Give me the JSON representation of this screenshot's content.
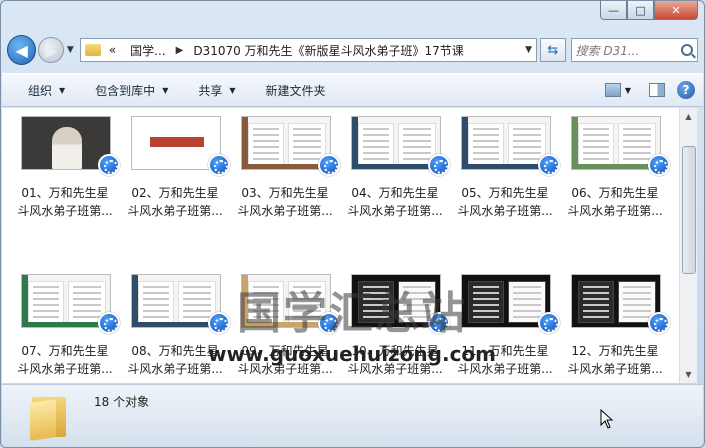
{
  "window": {
    "min_label": "—",
    "max_label": "□",
    "close_label": "✕"
  },
  "nav": {
    "back_glyph": "◀",
    "forward_glyph": "▶",
    "dropdown_glyph": "▼"
  },
  "address": {
    "overflow": "«",
    "crumbs": [
      "国学...",
      "D31070 万和先生《新版星斗风水弟子班》17节课"
    ],
    "sep_glyph": "▶",
    "dropdown_glyph": "▼",
    "refresh_glyph": "⇆"
  },
  "search": {
    "placeholder": "搜索 D31..."
  },
  "toolbar": {
    "items": [
      {
        "label": "组织",
        "has_dropdown": true
      },
      {
        "label": "包含到库中",
        "has_dropdown": true
      },
      {
        "label": "共享",
        "has_dropdown": true
      },
      {
        "label": "新建文件夹",
        "has_dropdown": false
      }
    ],
    "arrow_glyph": "▼",
    "help_label": "?"
  },
  "files": [
    {
      "line1": "01、万和先生星",
      "line2": "斗风水弟子班第...",
      "thumb": "video"
    },
    {
      "line1": "02、万和先生星",
      "line2": "斗风水弟子班第...",
      "thumb": "title-slide"
    },
    {
      "line1": "03、万和先生星",
      "line2": "斗风水弟子班第...",
      "thumb": "doc",
      "accent": "#8a5a3c"
    },
    {
      "line1": "04、万和先生星",
      "line2": "斗风水弟子班第...",
      "thumb": "doc",
      "accent": "#2f4d6a"
    },
    {
      "line1": "05、万和先生星",
      "line2": "斗风水弟子班第...",
      "thumb": "doc",
      "accent": "#2f4d6a"
    },
    {
      "line1": "06、万和先生星",
      "line2": "斗风水弟子班第...",
      "thumb": "doc",
      "accent": "#6a8f5a"
    },
    {
      "line1": "07、万和先生星",
      "line2": "斗风水弟子班第...",
      "thumb": "doc",
      "accent": "#2e7a4a"
    },
    {
      "line1": "08、万和先生星",
      "line2": "斗风水弟子班第...",
      "thumb": "doc",
      "accent": "#2f4d6a"
    },
    {
      "line1": "09、万和先生星",
      "line2": "斗风水弟子班第...",
      "thumb": "doc",
      "accent": "#c9a46a"
    },
    {
      "line1": "10、万和先生星",
      "line2": "斗风水弟子班第...",
      "thumb": "dark"
    },
    {
      "line1": "11、万和先生星",
      "line2": "斗风水弟子班第...",
      "thumb": "dark"
    },
    {
      "line1": "12、万和先生星",
      "line2": "斗风水弟子班第...",
      "thumb": "dark"
    }
  ],
  "watermark": {
    "cn": "国学汇总站",
    "url": "www.guoxuehuizong.com"
  },
  "scrollbar": {
    "up_glyph": "▲",
    "down_glyph": "▼"
  },
  "status": {
    "count_text": "18 个对象"
  }
}
